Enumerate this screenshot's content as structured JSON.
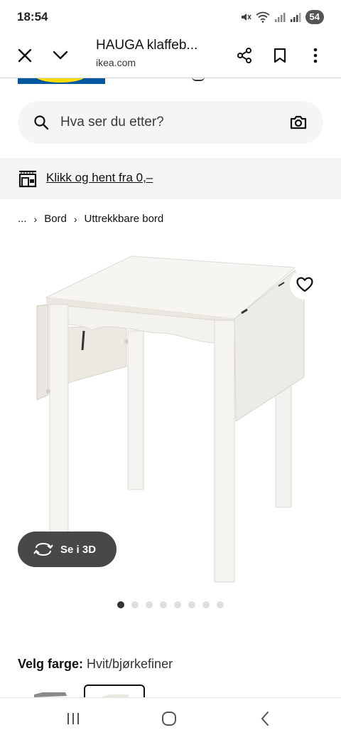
{
  "status": {
    "time": "18:54",
    "battery": "54"
  },
  "browser": {
    "title": "HAUGA klaffeb...",
    "url": "ikea.com",
    "icons": [
      "close-icon",
      "chevron-down-icon",
      "share-icon",
      "bookmark-icon",
      "more-vert-icon"
    ]
  },
  "search": {
    "placeholder": "Hva ser du etter?"
  },
  "promo": {
    "link_text": "Klikk og hent fra 0,–"
  },
  "breadcrumb": {
    "ellipsis": "...",
    "items": [
      "Bord",
      "Uttrekkbare bord"
    ]
  },
  "product": {
    "view3d_label": "Se i 3D",
    "carousel": {
      "total": 8,
      "active": 1
    }
  },
  "color": {
    "label": "Velg farge:",
    "value": "Hvit/bjørkefiner"
  },
  "colors": {
    "accent_blue": "#0058a3",
    "accent_yellow": "#ffdb00",
    "pill_dark": "#484848"
  }
}
